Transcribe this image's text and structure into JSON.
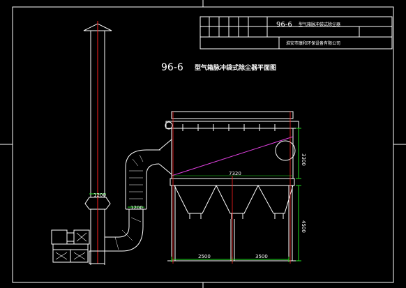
{
  "title_block": {
    "drawing_no": "96-6",
    "drawing_name": "型气箱脉冲袋式除尘器",
    "company": "淮安市康和环保设备有限公司"
  },
  "drawing_title": {
    "prefix": "96-6",
    "text": "型气箱脉冲袋式除尘器平面图"
  },
  "dimensions": {
    "chimney_width": "1200",
    "duct_width": "1200",
    "housing_length": "7320",
    "housing_height": "3300",
    "support_height": "4500",
    "left_span": "2500",
    "right_span": "3500"
  },
  "colors": {
    "background": "#000000",
    "linework": "#ffffff",
    "centerline": "#ff2020",
    "dimension": "#20e020",
    "diagonal": "#e040e0"
  }
}
